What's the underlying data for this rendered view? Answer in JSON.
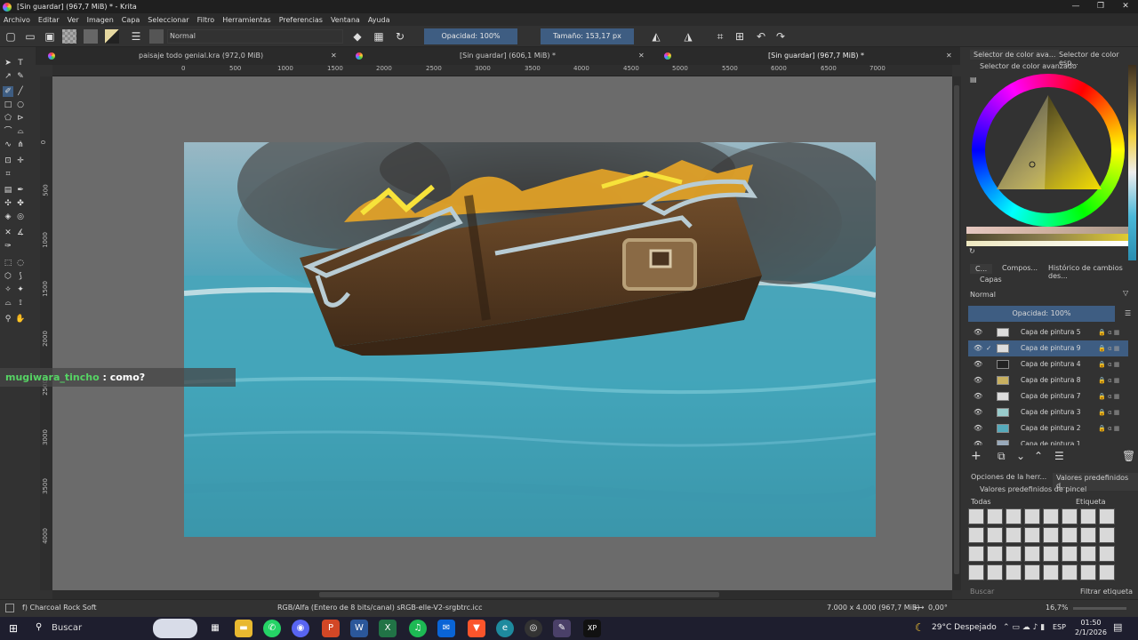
{
  "window": {
    "title": "[Sin guardar]  (967,7 MiB) * - Krita",
    "controls": [
      "—",
      "❐",
      "✕"
    ]
  },
  "menu": [
    "Archivo",
    "Editar",
    "Ver",
    "Imagen",
    "Capa",
    "Seleccionar",
    "Filtro",
    "Herramientas",
    "Preferencias",
    "Ventana",
    "Ayuda"
  ],
  "toolbar": {
    "blend_mode": "Normal",
    "opacity": "Opacidad: 100%",
    "size": "Tamaño: 153,17 px"
  },
  "tabs": [
    {
      "label": "paisaje todo genial.kra (972,0 MiB)"
    },
    {
      "label": "[Sin guardar]  (606,1 MiB) *"
    },
    {
      "label": "[Sin guardar]  (967,7 MiB) *"
    }
  ],
  "ruler_top": [
    "0",
    "500",
    "1000",
    "1500",
    "2000",
    "2500",
    "3000",
    "3500",
    "4000",
    "4500",
    "5000",
    "5500",
    "6000",
    "6500",
    "7000"
  ],
  "ruler_left": [
    "0",
    "500",
    "1000",
    "1500",
    "2000",
    "2500",
    "3000",
    "3500",
    "4000"
  ],
  "chat": {
    "user": "mugiwara_tincho",
    "message": " : como?"
  },
  "status": {
    "brush": "f) Charcoal Rock Soft",
    "colorspace": "RGB/Alfa (Entero de 8 bits/canal)  sRGB-elle-V2-srgbtrc.icc",
    "dimensions": "7.000 x 4.000 (967,7 MiB)",
    "rotation": "0,00°",
    "zoom": "16,7%"
  },
  "color_panel": {
    "tabs": [
      "Selector de color ava...",
      "Selector de color esp..."
    ],
    "title": "Selector de color avanzado"
  },
  "layers_panel": {
    "tabs": [
      "C...",
      "Compos...",
      "Histórico de cambios des..."
    ],
    "title": "Capas",
    "blend": "Normal",
    "opacity": "Opacidad:  100%",
    "layers": [
      {
        "name": "Capa de pintura 5",
        "selected": false,
        "checked": false
      },
      {
        "name": "Capa de pintura 9",
        "selected": true,
        "checked": true
      },
      {
        "name": "Capa de pintura 4",
        "selected": false,
        "checked": false
      },
      {
        "name": "Capa de pintura 8",
        "selected": false,
        "checked": false
      },
      {
        "name": "Capa de pintura 7",
        "selected": false,
        "checked": false
      },
      {
        "name": "Capa de pintura 3",
        "selected": false,
        "checked": false
      },
      {
        "name": "Capa de pintura 2",
        "selected": false,
        "checked": false
      },
      {
        "name": "Capa de pintura 1",
        "selected": false,
        "checked": false
      }
    ]
  },
  "brush_panel": {
    "tabs": [
      "Opciones de la herr...",
      "Valores predefinidos d..."
    ],
    "title": "Valores predefinidos de pincel",
    "filter": "Todas",
    "tag_label": "Etiqueta",
    "search_placeholder": "Buscar",
    "filter_tag": "Filtrar etiqueta"
  },
  "taskbar": {
    "search": "Buscar",
    "weather": "29°C  Despejado",
    "lang": "ESP",
    "time": "01:50",
    "date": "2/1/2026"
  }
}
